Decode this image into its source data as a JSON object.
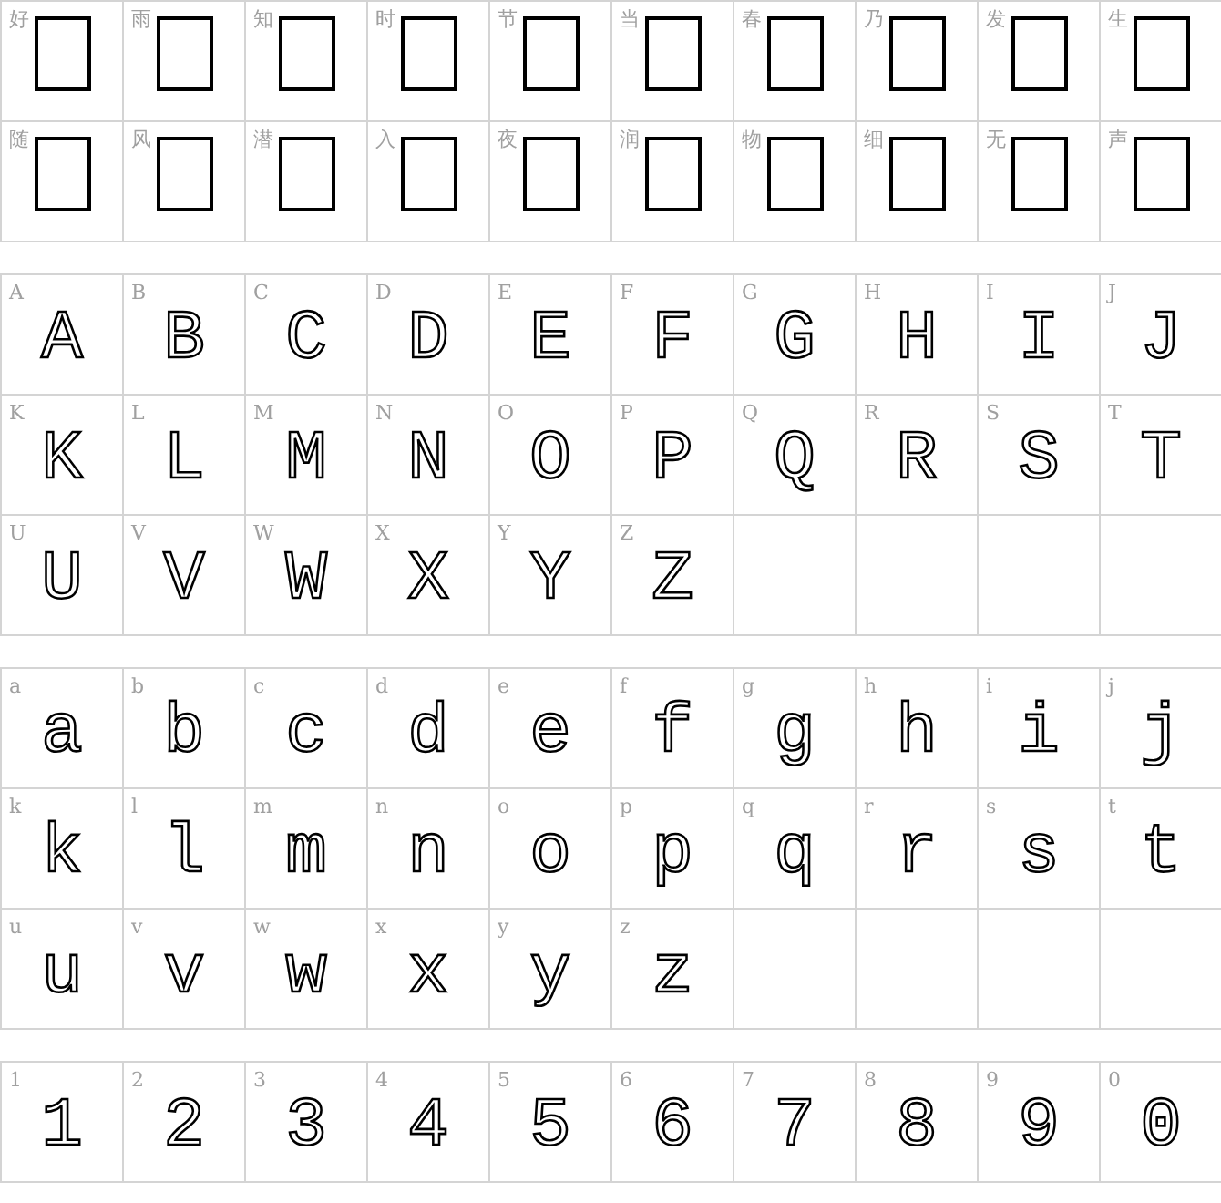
{
  "sections": [
    {
      "cells": [
        {
          "label": "好",
          "kind": "missing"
        },
        {
          "label": "雨",
          "kind": "missing"
        },
        {
          "label": "知",
          "kind": "missing"
        },
        {
          "label": "时",
          "kind": "missing"
        },
        {
          "label": "节",
          "kind": "missing"
        },
        {
          "label": "当",
          "kind": "missing"
        },
        {
          "label": "春",
          "kind": "missing"
        },
        {
          "label": "乃",
          "kind": "missing"
        },
        {
          "label": "发",
          "kind": "missing"
        },
        {
          "label": "生",
          "kind": "missing"
        },
        {
          "label": "随",
          "kind": "missing"
        },
        {
          "label": "风",
          "kind": "missing"
        },
        {
          "label": "潜",
          "kind": "missing"
        },
        {
          "label": "入",
          "kind": "missing"
        },
        {
          "label": "夜",
          "kind": "missing"
        },
        {
          "label": "润",
          "kind": "missing"
        },
        {
          "label": "物",
          "kind": "missing"
        },
        {
          "label": "细",
          "kind": "missing"
        },
        {
          "label": "无",
          "kind": "missing"
        },
        {
          "label": "声",
          "kind": "missing"
        }
      ]
    },
    {
      "cells": [
        {
          "label": "A",
          "kind": "glyph",
          "glyph": "A"
        },
        {
          "label": "B",
          "kind": "glyph",
          "glyph": "B"
        },
        {
          "label": "C",
          "kind": "glyph",
          "glyph": "C"
        },
        {
          "label": "D",
          "kind": "glyph",
          "glyph": "D"
        },
        {
          "label": "E",
          "kind": "glyph",
          "glyph": "E"
        },
        {
          "label": "F",
          "kind": "glyph",
          "glyph": "F"
        },
        {
          "label": "G",
          "kind": "glyph",
          "glyph": "G"
        },
        {
          "label": "H",
          "kind": "glyph",
          "glyph": "H"
        },
        {
          "label": "I",
          "kind": "glyph",
          "glyph": "I"
        },
        {
          "label": "J",
          "kind": "glyph",
          "glyph": "J"
        },
        {
          "label": "K",
          "kind": "glyph",
          "glyph": "K"
        },
        {
          "label": "L",
          "kind": "glyph",
          "glyph": "L"
        },
        {
          "label": "M",
          "kind": "glyph",
          "glyph": "M"
        },
        {
          "label": "N",
          "kind": "glyph",
          "glyph": "N"
        },
        {
          "label": "O",
          "kind": "glyph",
          "glyph": "O"
        },
        {
          "label": "P",
          "kind": "glyph",
          "glyph": "P"
        },
        {
          "label": "Q",
          "kind": "glyph",
          "glyph": "Q"
        },
        {
          "label": "R",
          "kind": "glyph",
          "glyph": "R"
        },
        {
          "label": "S",
          "kind": "glyph",
          "glyph": "S"
        },
        {
          "label": "T",
          "kind": "glyph",
          "glyph": "T"
        },
        {
          "label": "U",
          "kind": "glyph",
          "glyph": "U"
        },
        {
          "label": "V",
          "kind": "glyph",
          "glyph": "V"
        },
        {
          "label": "W",
          "kind": "glyph",
          "glyph": "W"
        },
        {
          "label": "X",
          "kind": "glyph",
          "glyph": "X"
        },
        {
          "label": "Y",
          "kind": "glyph",
          "glyph": "Y"
        },
        {
          "label": "Z",
          "kind": "glyph",
          "glyph": "Z"
        }
      ]
    },
    {
      "cells": [
        {
          "label": "a",
          "kind": "glyph",
          "glyph": "a"
        },
        {
          "label": "b",
          "kind": "glyph",
          "glyph": "b"
        },
        {
          "label": "c",
          "kind": "glyph",
          "glyph": "c"
        },
        {
          "label": "d",
          "kind": "glyph",
          "glyph": "d"
        },
        {
          "label": "e",
          "kind": "glyph",
          "glyph": "e"
        },
        {
          "label": "f",
          "kind": "glyph",
          "glyph": "f"
        },
        {
          "label": "g",
          "kind": "glyph",
          "glyph": "g"
        },
        {
          "label": "h",
          "kind": "glyph",
          "glyph": "h"
        },
        {
          "label": "i",
          "kind": "glyph",
          "glyph": "i"
        },
        {
          "label": "j",
          "kind": "glyph",
          "glyph": "j"
        },
        {
          "label": "k",
          "kind": "glyph",
          "glyph": "k"
        },
        {
          "label": "l",
          "kind": "glyph",
          "glyph": "l"
        },
        {
          "label": "m",
          "kind": "glyph",
          "glyph": "m"
        },
        {
          "label": "n",
          "kind": "glyph",
          "glyph": "n"
        },
        {
          "label": "o",
          "kind": "glyph",
          "glyph": "o"
        },
        {
          "label": "p",
          "kind": "glyph",
          "glyph": "p"
        },
        {
          "label": "q",
          "kind": "glyph",
          "glyph": "q"
        },
        {
          "label": "r",
          "kind": "glyph",
          "glyph": "r"
        },
        {
          "label": "s",
          "kind": "glyph",
          "glyph": "s"
        },
        {
          "label": "t",
          "kind": "glyph",
          "glyph": "t"
        },
        {
          "label": "u",
          "kind": "glyph",
          "glyph": "u"
        },
        {
          "label": "v",
          "kind": "glyph",
          "glyph": "v"
        },
        {
          "label": "w",
          "kind": "glyph",
          "glyph": "w"
        },
        {
          "label": "x",
          "kind": "glyph",
          "glyph": "x"
        },
        {
          "label": "y",
          "kind": "glyph",
          "glyph": "y"
        },
        {
          "label": "z",
          "kind": "glyph",
          "glyph": "z"
        }
      ]
    },
    {
      "cells": [
        {
          "label": "1",
          "kind": "glyph",
          "glyph": "1"
        },
        {
          "label": "2",
          "kind": "glyph",
          "glyph": "2"
        },
        {
          "label": "3",
          "kind": "glyph",
          "glyph": "3"
        },
        {
          "label": "4",
          "kind": "glyph",
          "glyph": "4"
        },
        {
          "label": "5",
          "kind": "glyph",
          "glyph": "5"
        },
        {
          "label": "6",
          "kind": "glyph",
          "glyph": "6"
        },
        {
          "label": "7",
          "kind": "glyph",
          "glyph": "7"
        },
        {
          "label": "8",
          "kind": "glyph",
          "glyph": "8"
        },
        {
          "label": "9",
          "kind": "glyph",
          "glyph": "9"
        },
        {
          "label": "0",
          "kind": "glyph",
          "glyph": "0"
        }
      ]
    }
  ]
}
